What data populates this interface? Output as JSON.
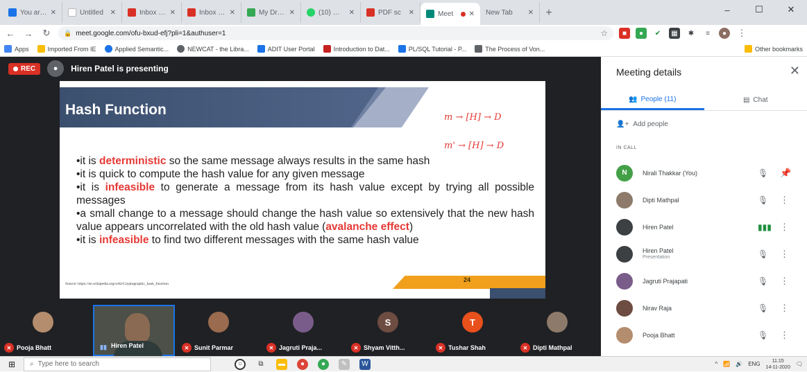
{
  "browser": {
    "tabs": [
      {
        "label": "You are ac",
        "color": "#1a73e8"
      },
      {
        "label": "Untitled",
        "color": "#ffffff"
      },
      {
        "label": "Inbox (670",
        "color": "#d93025"
      },
      {
        "label": "Inbox (171",
        "color": "#d93025"
      },
      {
        "label": "My Drive",
        "color": "#34a853"
      },
      {
        "label": "(10) WhatsA",
        "color": "#25d366"
      },
      {
        "label": "PDF sc",
        "color": "#d93025"
      },
      {
        "label": "Meet",
        "color": "#00897b"
      },
      {
        "label": "New Tab",
        "color": "#dee1e6"
      }
    ],
    "url": "meet.google.com/ofu-bxud-efj?pli=1&authuser=1",
    "bookmarks": [
      {
        "label": "Apps",
        "color": "#4285f4"
      },
      {
        "label": "Imported From IE",
        "color": "#fbbc04"
      },
      {
        "label": "Applied Semantic...",
        "color": "#1a73e8"
      },
      {
        "label": "NEWCAT - the Libra...",
        "color": "#5f6368"
      },
      {
        "label": "ADIT User Portal",
        "color": "#1a73e8"
      },
      {
        "label": "Introduction to Dat...",
        "color": "#c5221f"
      },
      {
        "label": "PL/SQL Tutorial - P...",
        "color": "#1a73e8"
      },
      {
        "label": "The Process of Von...",
        "color": "#5f6368"
      }
    ],
    "other_bookmarks": "Other bookmarks"
  },
  "meet": {
    "rec_label": "REC",
    "presenting": "Hiren Patel is presenting",
    "slide": {
      "title": "Hash Function",
      "scribble_1": "m → [H] → D",
      "scribble_2": "m' → [H] → D",
      "b1_pre": "•it is ",
      "b1_hl": "deterministic",
      "b1_post": " so the same message always results in the same hash",
      "b2": "•it is quick to compute the hash value for any given message",
      "b3_pre": "•it is ",
      "b3_hl": "infeasible",
      "b3_post": " to generate a message from its hash value except by trying all possible messages",
      "b4": "•a small change to a message should change the hash value so extensively that the new hash value appears uncorrelated with the old hash value (",
      "b4_hl": "avalanche effect",
      "b4_post": ")",
      "b5_pre": "•it is ",
      "b5_hl": "infeasible",
      "b5_post": " to find two different messages with the same hash value",
      "source": "Source: https://en.wikipedia.org/wiki/Cryptographic_hash_function",
      "page_number": "24"
    },
    "filmstrip": [
      {
        "name": "Pooja Bhatt",
        "muted": true,
        "color": "#b48d6e"
      },
      {
        "name": "Hiren Patel",
        "muted": false,
        "color": "#4c5049"
      },
      {
        "name": "Sunit Parmar",
        "muted": true,
        "color": "#9a6b4f"
      },
      {
        "name": "Jagruti Praja...",
        "muted": true,
        "color": "#7a5c8a"
      },
      {
        "name": "Shyam Vitth...",
        "muted": true,
        "color": "#6d4c41",
        "initial": "S"
      },
      {
        "name": "Tushar Shah",
        "muted": true,
        "color": "#e8501c",
        "initial": "T"
      },
      {
        "name": "Dipti Mathpal",
        "muted": true,
        "color": "#8d7a6a"
      }
    ]
  },
  "panel": {
    "title": "Meeting details",
    "tab_people": "People (11)",
    "tab_chat": "Chat",
    "add_people": "Add people",
    "in_call": "IN CALL",
    "people": [
      {
        "name": "Nirali Thakkar (You)",
        "sub": "",
        "initial": "N",
        "color": "#43a047",
        "mic": "muted",
        "action": "pin"
      },
      {
        "name": "Dipti Mathpal",
        "sub": "",
        "initial": "",
        "color": "#8d7a6a",
        "mic": "muted",
        "action": "more"
      },
      {
        "name": "Hiren Patel",
        "sub": "",
        "initial": "",
        "color": "#3c4043",
        "mic": "live",
        "action": "more"
      },
      {
        "name": "Hiren Patel",
        "sub": "Presentation",
        "initial": "",
        "color": "#3c4043",
        "mic": "muted",
        "action": "more"
      },
      {
        "name": "Jagruti Prajapati",
        "sub": "",
        "initial": "",
        "color": "#7a5c8a",
        "mic": "muted",
        "action": "more"
      },
      {
        "name": "Nirav Raja",
        "sub": "",
        "initial": "",
        "color": "#6d4c41",
        "mic": "muted",
        "action": "more"
      },
      {
        "name": "Pooja Bhatt",
        "sub": "",
        "initial": "",
        "color": "#b48d6e",
        "mic": "muted",
        "action": "more"
      }
    ]
  },
  "taskbar": {
    "search_placeholder": "Type here to search",
    "lang": "ENG",
    "time": "11:15",
    "date": "14-11-2020"
  }
}
